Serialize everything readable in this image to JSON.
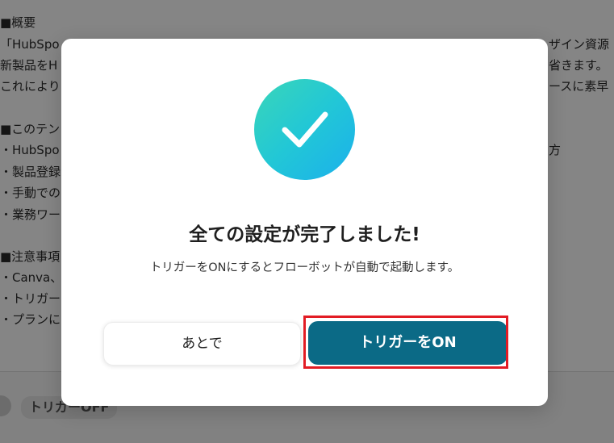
{
  "background": {
    "left_lines": [
      "■概要",
      "「HubSpo",
      "新製品をH",
      "これにより",
      "■このテン",
      "・HubSpo",
      "・製品登録",
      "・手動での",
      "・業務ワー",
      "■注意事項",
      "・Canva、H",
      "・トリガーは",
      "・プランによ"
    ],
    "right_lines": [
      "ザイン資源",
      "省きます。",
      "ースに素早",
      "方"
    ],
    "trigger_toggle_label": "トリガーOFF"
  },
  "modal": {
    "title": "全ての設定が完了しました!",
    "description": "トリガーをONにするとフローボットが自動で起動します。",
    "later_button": "あとで",
    "trigger_on_button": "トリガーをON",
    "icon": "check-icon",
    "colors": {
      "gradient_start": "#3ad6b8",
      "gradient_end": "#1bb0ec",
      "primary_button": "#0b6a86",
      "highlight": "#e21c24"
    }
  }
}
